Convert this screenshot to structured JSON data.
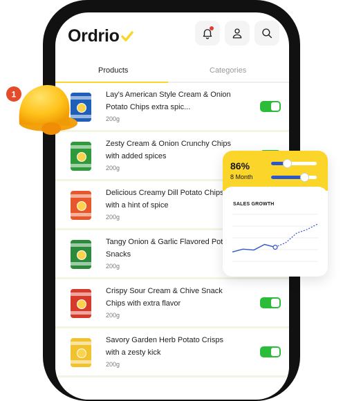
{
  "app": {
    "brand": "Ordrio"
  },
  "header": {
    "notification_icon": "bell-icon",
    "profile_icon": "user-icon",
    "search_icon": "search-icon"
  },
  "tabs": [
    {
      "label": "Products",
      "active": true
    },
    {
      "label": "Categories",
      "active": false
    }
  ],
  "products": [
    {
      "name": "Lay's American Style Cream & Onion Potato Chips extra spic...",
      "weight": "200g",
      "enabled": true,
      "color": "#1f5fb8"
    },
    {
      "name": "Zesty Cream & Onion Crunchy Chips with added spices",
      "weight": "200g",
      "enabled": true,
      "color": "#2f9a3a"
    },
    {
      "name": "Delicious Creamy Dill Potato Chips with a hint of spice",
      "weight": "200g",
      "enabled": true,
      "color": "#e8572a"
    },
    {
      "name": "Tangy Onion & Garlic Flavored Potato Snacks",
      "weight": "200g",
      "enabled": true,
      "color": "#2c8a3c"
    },
    {
      "name": "Crispy Sour Cream & Chive Snack Chips with extra flavor",
      "weight": "200g",
      "enabled": true,
      "color": "#d63a2a"
    },
    {
      "name": "Savory Garden Herb Potato Crisps with a zesty kick",
      "weight": "200g",
      "enabled": true,
      "color": "#f2c12e"
    }
  ],
  "notification_badge": {
    "count": "1"
  },
  "stats_card": {
    "percent": "86%",
    "period": "8 Month",
    "slider1_level": 0.35,
    "slider2_level": 0.72,
    "title": "SALES GROWTH"
  },
  "chart_data": {
    "type": "line",
    "title": "SALES GROWTH",
    "x": [
      1,
      2,
      3,
      4,
      5,
      6,
      7,
      8,
      9
    ],
    "series": [
      {
        "values": [
          10,
          13,
          12,
          18,
          15,
          20,
          30,
          34,
          40
        ],
        "style": "solid-then-dashed"
      }
    ],
    "ylim": [
      0,
      50
    ],
    "grid": true,
    "highlight_index": 4,
    "colors": {
      "line": "#2d57c8",
      "accent": "#fcd52b",
      "toggle": "#2bbd3a",
      "tab_active": "#fcd52b"
    }
  }
}
